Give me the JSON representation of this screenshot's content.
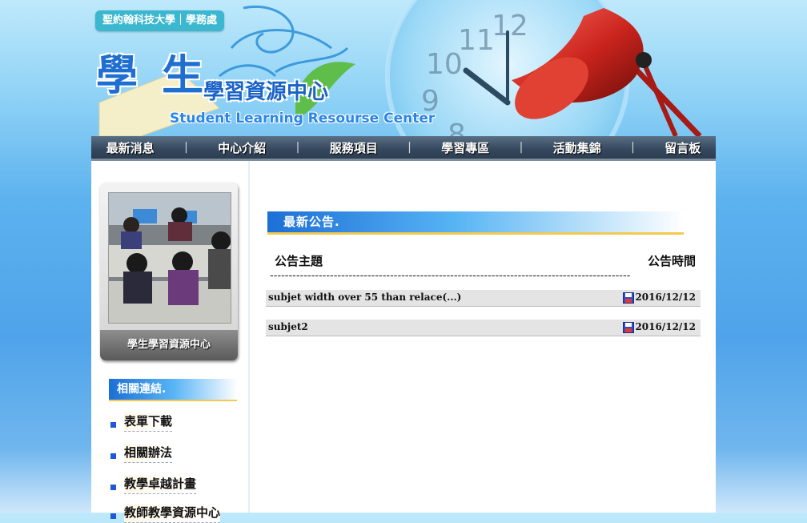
{
  "header": {
    "school_badge": "聖約翰科技大學｜學務處",
    "title_big": "學 生",
    "title_sub": "學習資源中心",
    "title_en": "Student Learning Resourse Center"
  },
  "nav": {
    "items": [
      "最新消息",
      "中心介紹",
      "服務項目",
      "學習專區",
      "活動集錦",
      "留言板"
    ],
    "separator": "|"
  },
  "sidebar": {
    "photo_caption": "學生學習資源中心",
    "links_title": "相關連結.",
    "links": [
      "表單下載",
      "相關辦法",
      "教學卓越計畫",
      "教師教學資源中心"
    ]
  },
  "news": {
    "title": "最新公告.",
    "col_subject": "公告主題",
    "col_time": "公告時間",
    "divider": "------------------------------------------------------------------------------------------------",
    "rows": [
      {
        "subject": "subjet width over 55 than relace(...)",
        "date": "2016/12/12"
      },
      {
        "subject": "subjet2",
        "date": "2016/12/12"
      }
    ]
  },
  "colors": {
    "nav_bg": "#34475c",
    "accent_blue": "#1c6fd6",
    "accent_gold": "#f3c94f",
    "row_bg": "#e4e4e4"
  }
}
